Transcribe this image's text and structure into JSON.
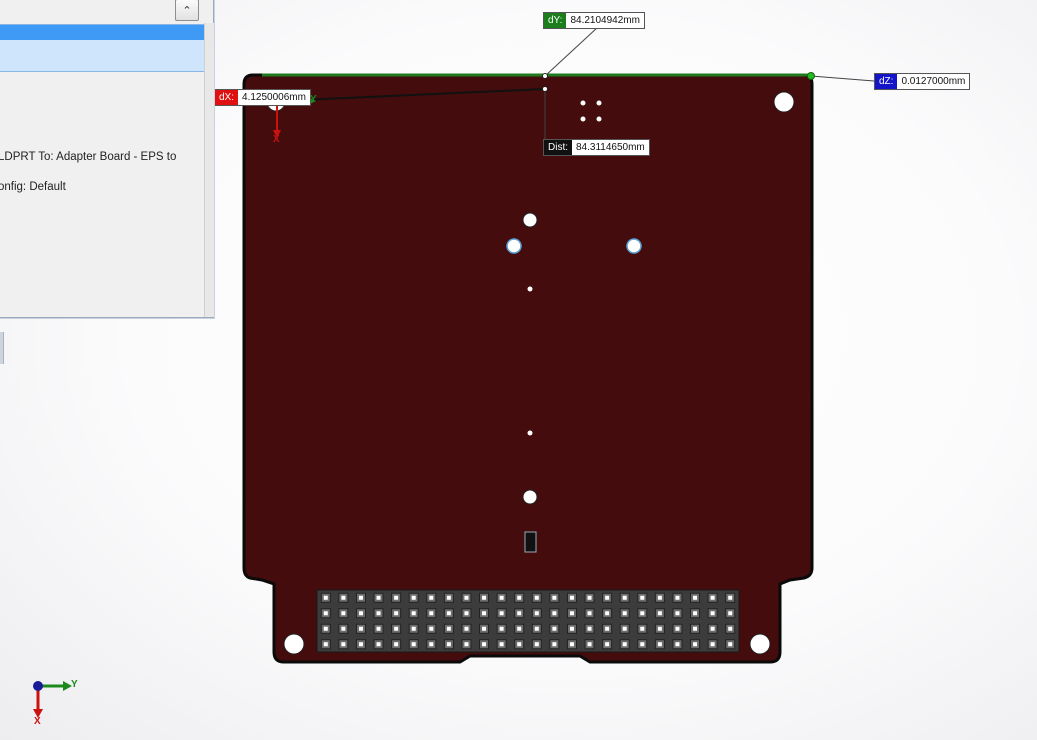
{
  "panel": {
    "collapse_glyph": "⌃",
    "line1": "LDPRT To: Adapter Board - EPS to",
    "line2": "onfig: Default"
  },
  "measure": {
    "dy_key": "dY:",
    "dy_value": "84.2104942mm",
    "dx_key": "dX:",
    "dx_value": "4.1250006mm",
    "dz_key": "dZ:",
    "dz_value": "0.0127000mm",
    "dist_key": "Dist:",
    "dist_value": "84.3114650mm"
  },
  "triad": {
    "y_label": "Y",
    "x_label": "X"
  },
  "part_triad": {
    "y_label": "Y",
    "x_label": "X"
  },
  "colors": {
    "board": "#440c0c",
    "dy_tag": "#1b7d1b",
    "dx_tag": "#e01010",
    "dz_tag": "#1414c8",
    "dist_tag": "#111111",
    "edge_highlight": "#1f7a1f"
  },
  "connector": {
    "rows": 4,
    "cols": 24
  }
}
